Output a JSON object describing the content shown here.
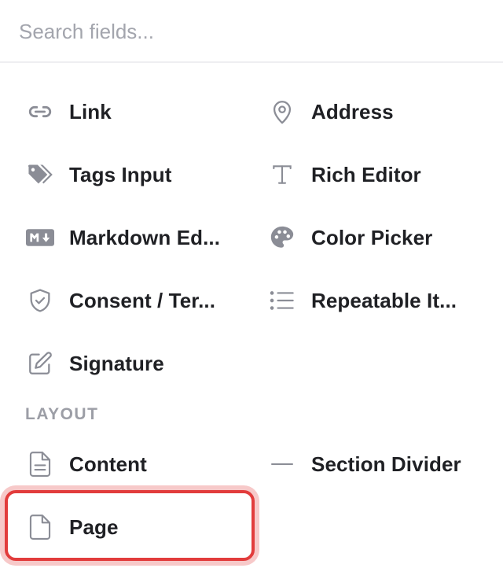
{
  "search": {
    "placeholder": "Search fields..."
  },
  "fields": [
    {
      "label": "Link",
      "icon": "link-icon"
    },
    {
      "label": "Address",
      "icon": "map-pin-icon"
    },
    {
      "label": "Tags Input",
      "icon": "tags-icon"
    },
    {
      "label": "Rich Editor",
      "icon": "text-type-icon"
    },
    {
      "label": "Markdown Ed...",
      "icon": "markdown-icon"
    },
    {
      "label": "Color Picker",
      "icon": "palette-icon"
    },
    {
      "label": "Consent / Ter...",
      "icon": "shield-check-icon"
    },
    {
      "label": "Repeatable It...",
      "icon": "list-icon"
    },
    {
      "label": "Signature",
      "icon": "pencil-square-icon"
    }
  ],
  "layout_section": {
    "title": "LAYOUT",
    "items": [
      {
        "label": "Content",
        "icon": "document-text-icon"
      },
      {
        "label": "Section Divider",
        "icon": "minus-icon"
      },
      {
        "label": "Page",
        "icon": "document-icon"
      }
    ]
  },
  "colors": {
    "icon": "#8b8d96",
    "text": "#1f2024",
    "highlight": "#e23c3c"
  }
}
